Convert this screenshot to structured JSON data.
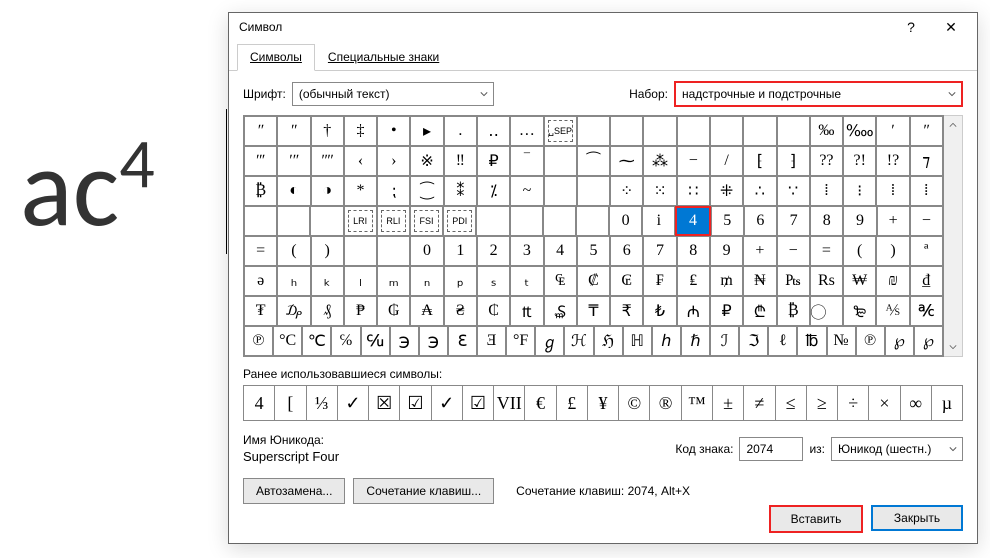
{
  "doc_preview": "ac⁴",
  "title": "Символ",
  "tabs": {
    "symbols": "Символы",
    "special": "Специальные знаки"
  },
  "font": {
    "label": "Шрифт:",
    "value": "(обычный текст)"
  },
  "range": {
    "label": "Набор:",
    "value": "надстрочные и подстрочные"
  },
  "grid": [
    [
      "ʺ",
      "ʺ",
      "†",
      "‡",
      "•",
      "▸",
      ".",
      "‥",
      "…",
      "␣SEP",
      "",
      "",
      "",
      "",
      "",
      "",
      "",
      "‰",
      "‱",
      "ʹ",
      "ʺ"
    ],
    [
      "ʺʹ",
      "ʹʺ",
      "ʺʺ",
      "‹",
      "›",
      "※",
      "‼",
      "₽",
      "‾",
      "",
      "⁀",
      "⁓",
      "⁂",
      "−",
      "/",
      "⁅",
      "⁆",
      "??",
      "?!",
      "!?",
      "⁊"
    ],
    [
      "₿",
      "◐",
      "◑",
      "*",
      "⁏",
      "⁐",
      "⁑",
      "⁒",
      "~",
      "",
      "",
      "⁘",
      "⁙",
      "∷",
      "⁜",
      "∴",
      "∵",
      "⁞",
      "⁝",
      "⁞",
      "⁞"
    ],
    [
      "",
      "",
      "",
      "LRI",
      "RLI",
      "FSI",
      "PDI",
      "",
      "",
      "",
      "",
      "0",
      "i",
      "4",
      "5",
      "6",
      "7",
      "8",
      "9",
      "+",
      "−"
    ],
    [
      "=",
      "(",
      ")",
      "",
      "",
      "0",
      "1",
      "2",
      "3",
      "4",
      "5",
      "6",
      "7",
      "8",
      "9",
      "+",
      "−",
      "=",
      "(",
      ")",
      "ª"
    ],
    [
      "ə",
      "ₕ",
      "ₖ",
      "ₗ",
      "ₘ",
      "ₙ",
      "ₚ",
      "ₛ",
      "ₜ",
      "₠",
      "₡",
      "₢",
      "₣",
      "₤",
      "₥",
      "₦",
      "₧",
      "Rs",
      "₩",
      "₪",
      "₫"
    ],
    [
      "₮",
      "₯",
      "₰",
      "₱",
      "₲",
      "₳",
      "₴",
      "₵",
      "₶",
      "₷",
      "₸",
      "₹",
      "₺",
      "₼",
      "₽",
      "₾",
      "₿",
      "⃝",
      "₻",
      "⅍",
      "℀"
    ],
    [
      "℗",
      "°C",
      "℃",
      "℅",
      "℆",
      "℈",
      "℈",
      "ℇ",
      "Ǝ",
      "°F",
      "ℊ",
      "ℋ",
      "ℌ",
      "ℍ",
      "ℎ",
      "ℏ",
      "ℐ",
      "ℑ",
      "ℓ",
      "℔",
      "№",
      "℗",
      "℘",
      "℘"
    ]
  ],
  "selected_cell": {
    "row": 3,
    "col": 13
  },
  "recent": {
    "label": "Ранее использовавшиеся символы:"
  },
  "recent_cells": [
    "4",
    "[",
    "⅓",
    "✓",
    "☒",
    "☑",
    "✓",
    "☑",
    "VII",
    "€",
    "£",
    "¥",
    "©",
    "®",
    "™",
    "±",
    "≠",
    "≤",
    "≥",
    "÷",
    "×",
    "∞",
    "µ"
  ],
  "unicode": {
    "label": "Имя Юникода:",
    "name": "Superscript Four"
  },
  "code": {
    "label": "Код знака:",
    "value": "2074",
    "from_label": "из:",
    "from_value": "Юникод (шестн.)"
  },
  "buttons": {
    "auto": "Автозамена...",
    "shortcut": "Сочетание клавиш..."
  },
  "hint": "Сочетание клавиш: 2074, Alt+X",
  "footer": {
    "insert": "Вставить",
    "close": "Закрыть"
  }
}
